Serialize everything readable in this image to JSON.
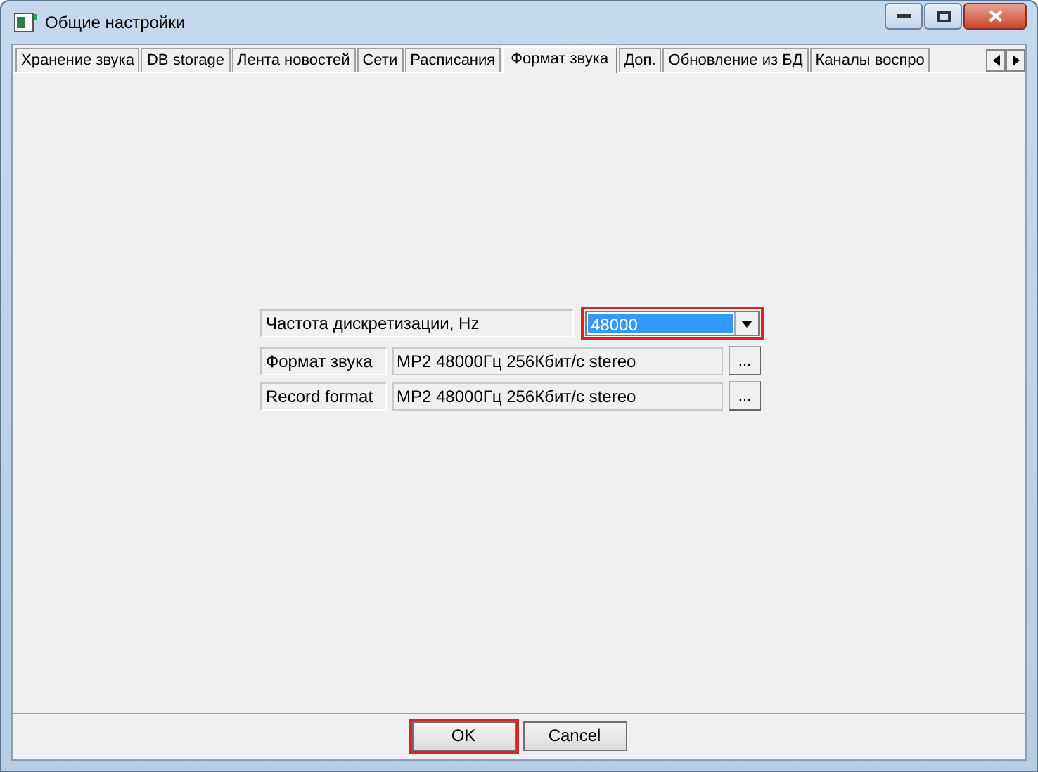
{
  "window": {
    "title": "Общие настройки"
  },
  "tabs": [
    {
      "label": "Хранение звука",
      "selected": false
    },
    {
      "label": "DB storage",
      "selected": false
    },
    {
      "label": "Лента новостей",
      "selected": false
    },
    {
      "label": "Сети",
      "selected": false
    },
    {
      "label": "Расписания",
      "selected": false
    },
    {
      "label": "Формат звука",
      "selected": true
    },
    {
      "label": "Доп.",
      "selected": false
    },
    {
      "label": "Обновление из БД",
      "selected": false
    },
    {
      "label": "Каналы воспро",
      "selected": false
    }
  ],
  "sample_rate": {
    "label": "Частота дискретизации, Hz",
    "value": "48000",
    "highlighted": true
  },
  "rows": [
    {
      "label": "Формат звука",
      "value": "MP2 48000Гц 256Кбит/с stereo",
      "button": "..."
    },
    {
      "label": "Record format",
      "value": "MP2 48000Гц 256Кбит/с stereo",
      "button": "..."
    }
  ],
  "buttons": [
    {
      "label": "OK",
      "highlighted": true
    },
    {
      "label": "Cancel",
      "highlighted": false
    }
  ]
}
